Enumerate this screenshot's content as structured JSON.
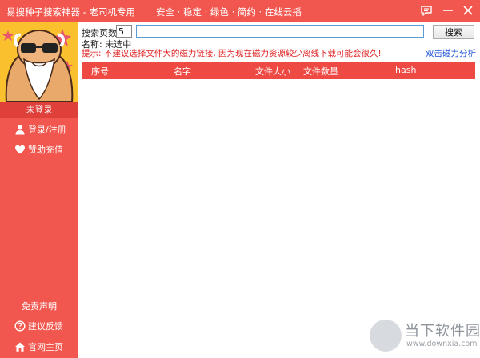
{
  "titlebar": {
    "app_title": "易搜种子搜索神器  -  老司机专用",
    "slogan": "安全 · 稳定 · 绿色 · 简约 · 在线云播"
  },
  "sidebar": {
    "login_status": "未登录",
    "login_register": "登录/注册",
    "donate": "赞助充值",
    "disclaimer": "免责声明",
    "feedback": "建议反馈",
    "homepage": "官网主页"
  },
  "search": {
    "pages_label": "搜索页数:",
    "pages_value": "5",
    "query_value": "",
    "button_label": "搜索"
  },
  "info": {
    "name_line": "名称: 未选中",
    "tip": "提示: 不建议选择文件大的磁力链接, 因为现在磁力资源较少离线下载可能会很久!",
    "analyze_link": "双击磁力分析"
  },
  "table": {
    "columns": [
      "序号",
      "名字",
      "文件大小",
      "文件数量",
      "hash"
    ]
  },
  "watermark": {
    "main": "当下软件园",
    "sub": "www.downxia.com"
  },
  "colors": {
    "accent": "#f2574f",
    "header": "#ee4a43",
    "tip": "#e02020",
    "link": "#1a4fd6"
  },
  "icons": {
    "message": "message-icon",
    "minimize": "minimize-icon",
    "close": "close-icon",
    "user": "user-icon",
    "heart": "heart-icon",
    "question": "question-icon",
    "home": "home-icon"
  }
}
